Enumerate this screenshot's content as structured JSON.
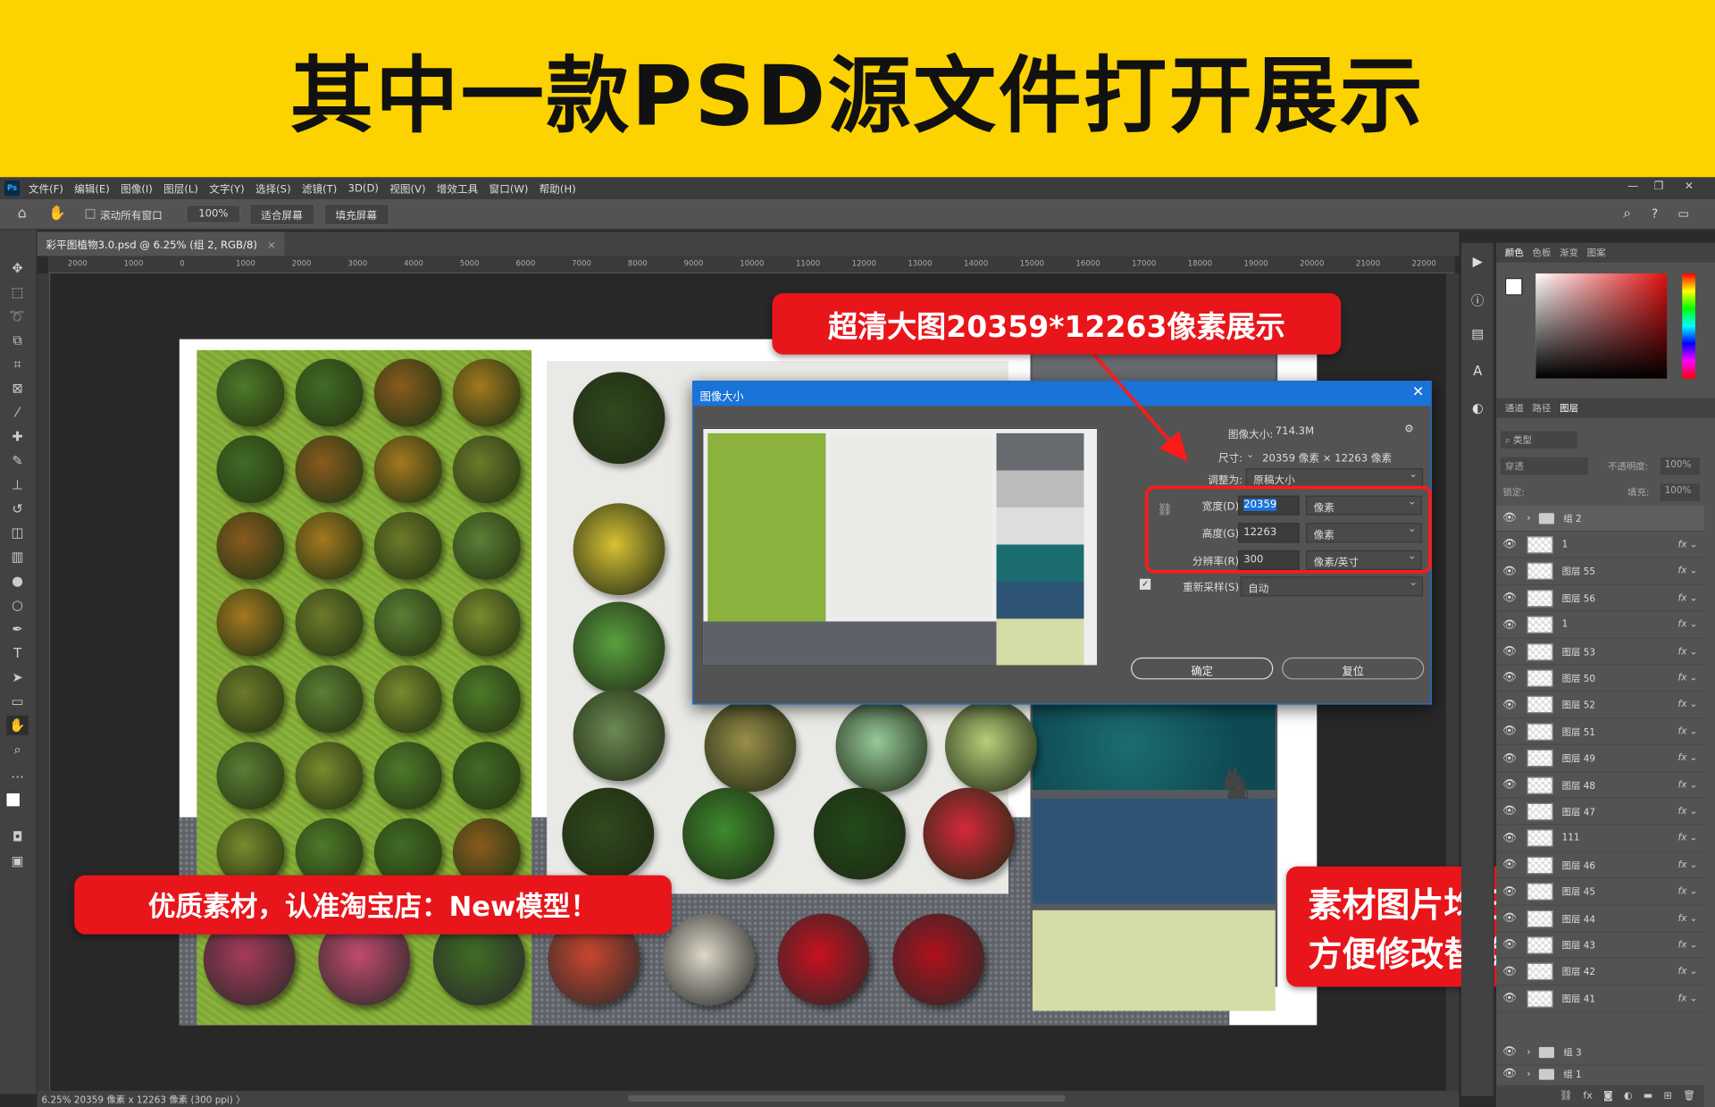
{
  "banner": {
    "title": "其中一款PSD源文件打开展示"
  },
  "menu": {
    "items": [
      "文件(F)",
      "编辑(E)",
      "图像(I)",
      "图层(L)",
      "文字(Y)",
      "选择(S)",
      "滤镜(T)",
      "3D(D)",
      "视图(V)",
      "增效工具",
      "窗口(W)",
      "帮助(H)"
    ]
  },
  "options": {
    "scroll_all": "滚动所有窗口",
    "zoom": "100%",
    "fit_screen": "适合屏幕",
    "fill_screen": "填充屏幕"
  },
  "document": {
    "tab_title": "彩平图植物3.0.psd @ 6.25% (组 2, RGB/8)",
    "status": "6.25%  20359 像素 x 12263 像素 (300 ppi)  〉"
  },
  "ruler": {
    "ticks": [
      "2000",
      "1000",
      "0",
      "1000",
      "2000",
      "3000",
      "4000",
      "5000",
      "6000",
      "7000",
      "8000",
      "9000",
      "10000",
      "11000",
      "12000",
      "13000",
      "14000",
      "15000",
      "16000",
      "17000",
      "18000",
      "19000",
      "20000",
      "21000",
      "22000"
    ]
  },
  "dialog": {
    "title": "图像大小",
    "image_size_label": "图像大小:",
    "image_size_value": "714.3M",
    "dimensions_label": "尺寸:",
    "dimensions_value": "20359 像素  ×  12263 像素",
    "fit_to_label": "调整为:",
    "fit_to_value": "原稿大小",
    "width_label": "宽度(D):",
    "width_value": "20359",
    "width_unit": "像素",
    "height_label": "高度(G):",
    "height_value": "12263",
    "height_unit": "像素",
    "resolution_label": "分辨率(R):",
    "resolution_value": "300",
    "resolution_unit": "像素/英寸",
    "resample_label": "重新采样(S):",
    "resample_value": "自动",
    "ok": "确定",
    "reset": "复位"
  },
  "callouts": {
    "top": "超清大图20359*12263像素展示",
    "left": "优质素材，认准淘宝店：New模型！",
    "right_line1": "素材图片均已分层",
    "right_line2": "方便修改替换"
  },
  "color_panel": {
    "tabs": [
      "颜色",
      "色板",
      "渐变",
      "图案"
    ]
  },
  "layers_panel": {
    "tabs": [
      "通道",
      "路径",
      "图层"
    ],
    "filter_placeholder": "类型",
    "blend_mode": "穿透",
    "opacity_label": "不透明度:",
    "opacity_value": "100%",
    "lock_label": "锁定:",
    "fill_label": "填充:",
    "fill_value": "100%",
    "layers": [
      {
        "name": "组 2",
        "type": "group",
        "fx": false
      },
      {
        "name": "1",
        "type": "layer",
        "fx": true
      },
      {
        "name": "图层 55",
        "type": "layer",
        "fx": true
      },
      {
        "name": "图层 56",
        "type": "layer",
        "fx": true
      },
      {
        "name": "1",
        "type": "layer",
        "fx": true
      },
      {
        "name": "图层 53",
        "type": "layer",
        "fx": true
      },
      {
        "name": "图层 50",
        "type": "layer",
        "fx": true
      },
      {
        "name": "图层 52",
        "type": "layer",
        "fx": true
      },
      {
        "name": "图层 51",
        "type": "layer",
        "fx": true
      },
      {
        "name": "图层 49",
        "type": "layer",
        "fx": true
      },
      {
        "name": "图层 48",
        "type": "layer",
        "fx": true
      },
      {
        "name": "图层 47",
        "type": "layer",
        "fx": true
      },
      {
        "name": "111",
        "type": "layer",
        "fx": true
      },
      {
        "name": "图层 46",
        "type": "layer",
        "fx": true
      },
      {
        "name": "图层 45",
        "type": "layer",
        "fx": true
      },
      {
        "name": "图层 44",
        "type": "layer",
        "fx": true
      },
      {
        "name": "图层 43",
        "type": "layer",
        "fx": true
      },
      {
        "name": "图层 42",
        "type": "layer",
        "fx": true
      },
      {
        "name": "图层 41",
        "type": "layer",
        "fx": true
      },
      {
        "name": "组 3",
        "type": "group",
        "fx": false
      },
      {
        "name": "组 1",
        "type": "group",
        "fx": false
      }
    ]
  },
  "colors": {
    "banner": "#fcd200",
    "accent_red": "#e8151b",
    "ps_blue": "#1a73d8"
  }
}
